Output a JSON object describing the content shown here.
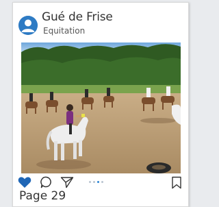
{
  "post": {
    "author": "Gué de Frise",
    "category": "Equitation",
    "avatar_icon": "user-avatar-icon",
    "photo_alt": "Jeunes cavaliers à poney dans une carrière en sable"
  },
  "actions": {
    "like_icon": "heart-icon",
    "comment_icon": "comment-bubble-icon",
    "share_icon": "paper-plane-icon",
    "save_icon": "bookmark-icon",
    "like_color": "#1f66b6",
    "carousel": {
      "count": 4,
      "active_index": 2
    }
  },
  "footer": {
    "page_label": "Page 29"
  },
  "colors": {
    "accent": "#2e7bc4",
    "text": "#333333"
  }
}
